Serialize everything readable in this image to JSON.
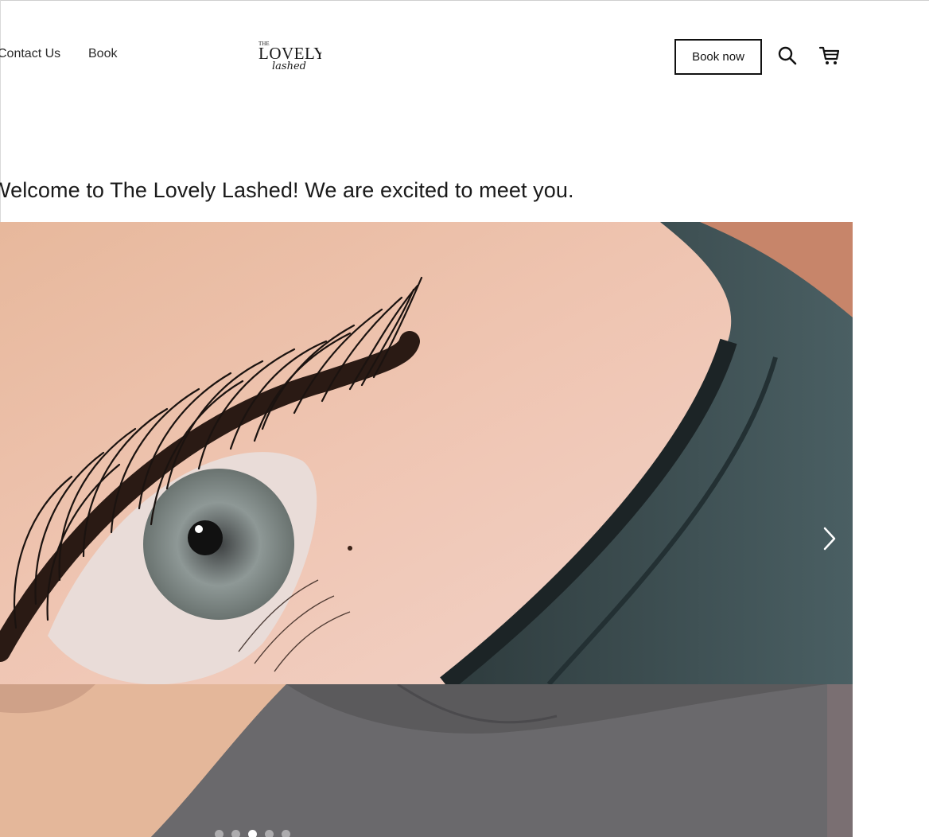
{
  "header": {
    "nav": [
      {
        "label": "Contact Us"
      },
      {
        "label": "Book"
      }
    ],
    "logo": {
      "the": "THE",
      "lovely": "LOVELY",
      "lashed": "lashed"
    },
    "book_now_label": "Book now",
    "search_icon": "search-icon",
    "cart_icon": "cart-icon"
  },
  "welcome_text": "Welcome to The Lovely Lashed! We are excited to meet you.",
  "slideshow": {
    "next_icon": "chevron-right-icon",
    "dot_count": 5,
    "active_dot": 2
  },
  "colors": {
    "text": "#1f1f1f",
    "button_border": "#111111",
    "background": "#ffffff"
  }
}
